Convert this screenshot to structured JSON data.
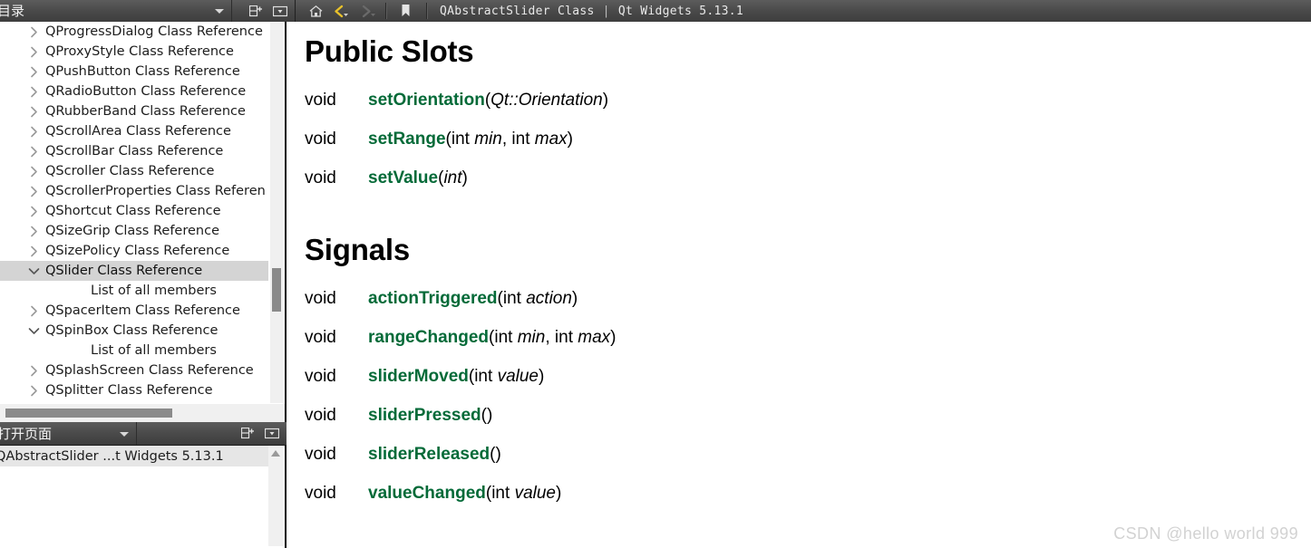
{
  "toolbar": {
    "dock_title": "目录",
    "add_pane_icon": "add-pane-icon",
    "pane_menu_icon": "pane-menu-icon",
    "home_icon": "home-icon",
    "back_icon": "back-arrow-icon",
    "forward_icon": "forward-arrow-icon",
    "bookmark_icon": "bookmark-icon",
    "page_title": "QAbstractSlider Class",
    "page_title_separator": "|",
    "page_subtitle": "Qt Widgets 5.13.1"
  },
  "sidebar": {
    "items": [
      {
        "label": "QProgressDialog Class Reference",
        "state": "collapsed",
        "level": 0
      },
      {
        "label": "QProxyStyle Class Reference",
        "state": "collapsed",
        "level": 0
      },
      {
        "label": "QPushButton Class Reference",
        "state": "collapsed",
        "level": 0
      },
      {
        "label": "QRadioButton Class Reference",
        "state": "collapsed",
        "level": 0
      },
      {
        "label": "QRubberBand Class Reference",
        "state": "collapsed",
        "level": 0
      },
      {
        "label": "QScrollArea Class Reference",
        "state": "collapsed",
        "level": 0
      },
      {
        "label": "QScrollBar Class Reference",
        "state": "collapsed",
        "level": 0
      },
      {
        "label": "QScroller Class Reference",
        "state": "collapsed",
        "level": 0
      },
      {
        "label": "QScrollerProperties Class Referen",
        "state": "collapsed",
        "level": 0
      },
      {
        "label": "QShortcut Class Reference",
        "state": "collapsed",
        "level": 0
      },
      {
        "label": "QSizeGrip Class Reference",
        "state": "collapsed",
        "level": 0
      },
      {
        "label": "QSizePolicy Class Reference",
        "state": "collapsed",
        "level": 0
      },
      {
        "label": "QSlider Class Reference",
        "state": "expanded",
        "level": 0,
        "selected": true
      },
      {
        "label": "List of all members",
        "state": "leaf",
        "level": 1
      },
      {
        "label": "QSpacerItem Class Reference",
        "state": "collapsed",
        "level": 0
      },
      {
        "label": "QSpinBox Class Reference",
        "state": "expanded",
        "level": 0
      },
      {
        "label": "List of all members",
        "state": "leaf",
        "level": 1
      },
      {
        "label": "QSplashScreen Class Reference",
        "state": "collapsed",
        "level": 0
      },
      {
        "label": "QSplitter Class Reference",
        "state": "collapsed",
        "level": 0
      }
    ]
  },
  "bottom_dock": {
    "title": "打开页面",
    "add_pane_icon": "add-pane-icon",
    "pane_menu_icon": "pane-menu-icon",
    "open_pages": [
      {
        "label": "QAbstractSlider ...t Widgets 5.13.1",
        "selected": true
      }
    ]
  },
  "main": {
    "sections": [
      {
        "heading": "Public Slots",
        "functions": [
          {
            "ret": "void",
            "name": "setOrientation",
            "args": [
              {
                "type": "",
                "name": "Qt::Orientation",
                "italic": true
              }
            ]
          },
          {
            "ret": "void",
            "name": "setRange",
            "args": [
              {
                "type": "int ",
                "name": "min",
                "italic": true
              },
              {
                "type": "int ",
                "name": "max",
                "italic": true
              }
            ]
          },
          {
            "ret": "void",
            "name": "setValue",
            "args": [
              {
                "type": "",
                "name": "int",
                "italic": true
              }
            ]
          }
        ]
      },
      {
        "heading": "Signals",
        "functions": [
          {
            "ret": "void",
            "name": "actionTriggered",
            "args": [
              {
                "type": "int ",
                "name": "action",
                "italic": true
              }
            ]
          },
          {
            "ret": "void",
            "name": "rangeChanged",
            "args": [
              {
                "type": "int ",
                "name": "min",
                "italic": true
              },
              {
                "type": "int ",
                "name": "max",
                "italic": true
              }
            ]
          },
          {
            "ret": "void",
            "name": "sliderMoved",
            "args": [
              {
                "type": "int ",
                "name": "value",
                "italic": true
              }
            ]
          },
          {
            "ret": "void",
            "name": "sliderPressed",
            "args": []
          },
          {
            "ret": "void",
            "name": "sliderReleased",
            "args": []
          },
          {
            "ret": "void",
            "name": "valueChanged",
            "args": [
              {
                "type": "int ",
                "name": "value",
                "italic": true
              }
            ]
          }
        ]
      }
    ]
  },
  "watermark": "CSDN @hello world 999",
  "colors": {
    "link_green": "#046A38",
    "chrome_dark": "#4a4a4a",
    "selection_gray": "#d4d4d4",
    "scrollbar_thumb": "#8a8a8a",
    "watermark_gray": "#d2d2d2"
  }
}
